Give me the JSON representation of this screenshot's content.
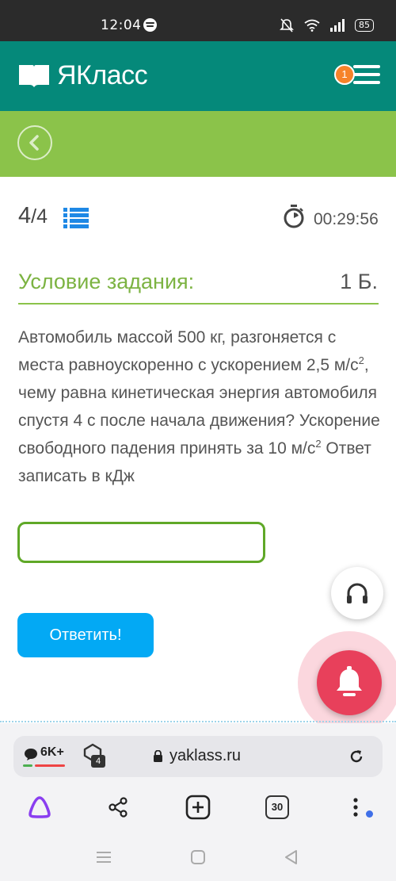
{
  "status_bar": {
    "time": "12:04",
    "battery": "85"
  },
  "header": {
    "logo_text": "ЯКласс",
    "notification_count": "1"
  },
  "task_header": {
    "current": "4",
    "total": "/4",
    "timer": "00:29:56"
  },
  "condition": {
    "title": "Условие задания:",
    "points": "1 Б."
  },
  "task": {
    "part1": "Автомобиль массой 500 кг, разгоняется с места равноускоренно с ускорением 2,5 м/с",
    "sup1": "2",
    "part2": ", чему равна кинетическая энергия автомобиля спустя 4 с после начала движения? Ускорение свободного падения принять за 10 м/с",
    "sup2": "2",
    "part3": "  Ответ записать в кДж"
  },
  "answer": {
    "value": ""
  },
  "submit": {
    "label": "Ответить!"
  },
  "browser": {
    "comments_count": "6K+",
    "shield_count": "4",
    "url": "yaklass.ru",
    "tabs_count": "30"
  },
  "colors": {
    "header": "#05897a",
    "subheader": "#8bc34a",
    "submit": "#03a9f4",
    "bell": "#e8405b",
    "badge": "#f6832a"
  },
  "icons": [
    "back-icon",
    "list-icon",
    "stopwatch-icon",
    "headphones-icon",
    "bell-icon",
    "lock-icon",
    "reload-icon",
    "share-icon",
    "add-tab-icon",
    "more-icon",
    "alice-icon"
  ]
}
